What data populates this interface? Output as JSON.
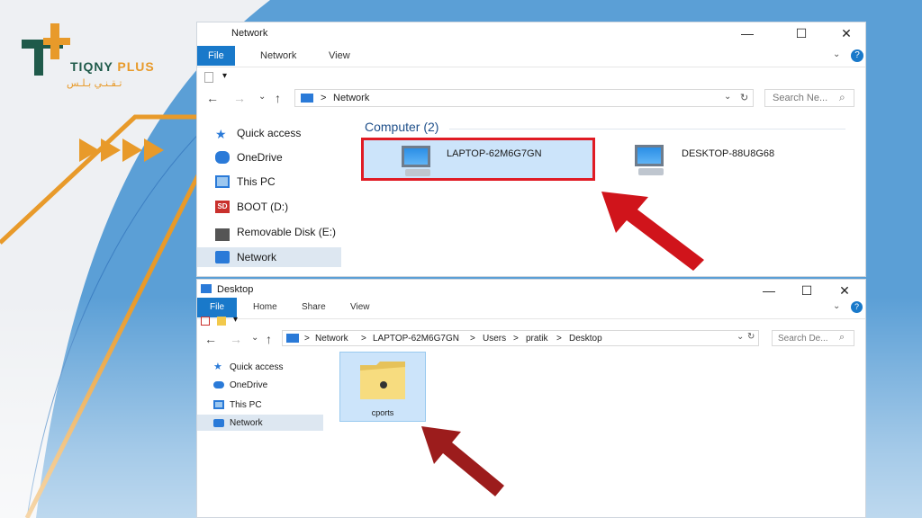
{
  "brand": {
    "name_a": "TIQNY",
    "name_b": "PLUS",
    "name_ar": "تـقـنـي   بـلـس"
  },
  "colors": {
    "accent": "#1979ca",
    "highlight_box": "#e01b24",
    "arrow": "#d0141b",
    "brand_orange": "#e89a2a",
    "brand_green": "#1f5a4a"
  },
  "top_window": {
    "title": "Network",
    "controls": {
      "minimize": "—",
      "maximize": "☐",
      "close": "✕"
    },
    "ribbon": {
      "tabs": [
        "File",
        "Network",
        "View"
      ]
    },
    "address": {
      "path_root": "Network",
      "sep": ">"
    },
    "search": {
      "placeholder": "Search Ne..."
    },
    "sidebar": [
      {
        "label": "Quick access",
        "icon": "star-icon"
      },
      {
        "label": "OneDrive",
        "icon": "cloud-icon"
      },
      {
        "label": "This PC",
        "icon": "computer-icon"
      },
      {
        "label": "BOOT (D:)",
        "icon": "sd-card-icon"
      },
      {
        "label": "Removable Disk (E:)",
        "icon": "drive-icon"
      },
      {
        "label": "Network",
        "icon": "network-icon"
      }
    ],
    "group_header": "Computer (2)",
    "items": [
      {
        "label": "LAPTOP-62M6G7GN"
      },
      {
        "label": "DESKTOP-88U8G68"
      }
    ]
  },
  "bottom_window": {
    "title": "Desktop",
    "controls": {
      "minimize": "—",
      "maximize": "☐",
      "close": "✕"
    },
    "ribbon": {
      "tabs": [
        "File",
        "Home",
        "Share",
        "View"
      ]
    },
    "address": {
      "segments": [
        "Network",
        "LAPTOP-62M6G7GN",
        "Users",
        "pratik",
        "Desktop"
      ],
      "sep": ">"
    },
    "search": {
      "placeholder": "Search De..."
    },
    "sidebar": [
      {
        "label": "Quick access",
        "icon": "star-icon"
      },
      {
        "label": "OneDrive",
        "icon": "cloud-icon"
      },
      {
        "label": "This PC",
        "icon": "computer-icon"
      },
      {
        "label": "Network",
        "icon": "network-icon"
      }
    ],
    "items": [
      {
        "label": "cports"
      }
    ]
  }
}
